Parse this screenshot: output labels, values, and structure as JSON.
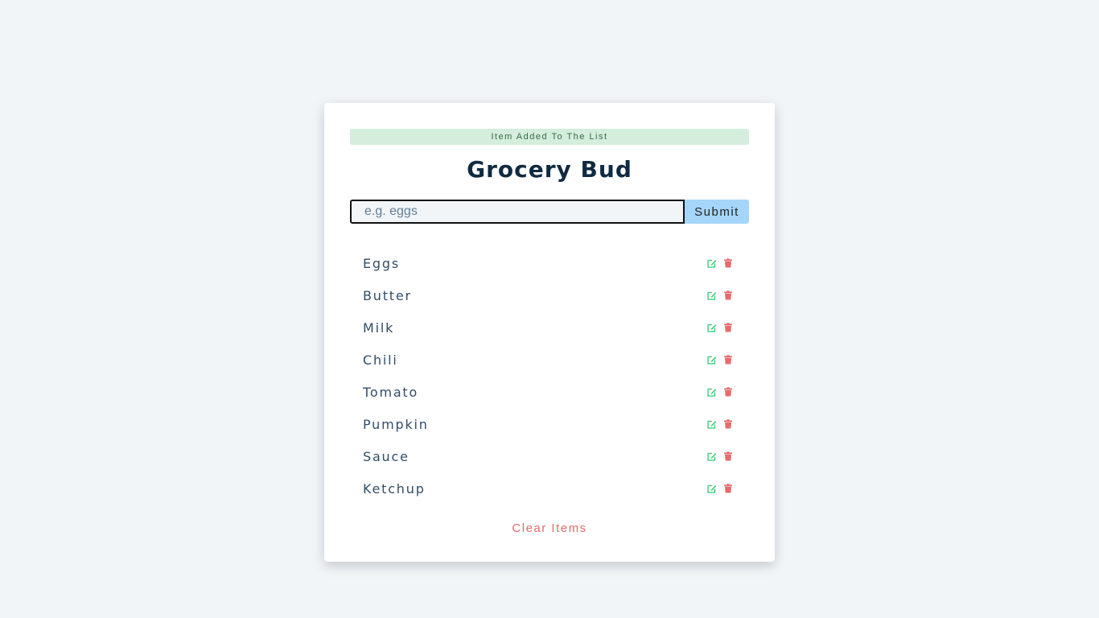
{
  "alert": {
    "text": "Item Added To The List",
    "color": "#d4eddc"
  },
  "header": {
    "title": "Grocery Bud"
  },
  "form": {
    "input_value": "",
    "input_placeholder": "e.g. eggs",
    "submit_label": "Submit",
    "submit_color": "#a5d5f8"
  },
  "items": [
    {
      "name": "Eggs"
    },
    {
      "name": "Butter"
    },
    {
      "name": "Milk"
    },
    {
      "name": "Chili"
    },
    {
      "name": "Tomato"
    },
    {
      "name": "Pumpkin"
    },
    {
      "name": "Sauce"
    },
    {
      "name": "Ketchup"
    }
  ],
  "icons": {
    "edit": "edit-icon",
    "delete": "trash-icon",
    "edit_color": "#2ecc71",
    "delete_color": "#e66b6b"
  },
  "footer": {
    "clear_label": "Clear Items"
  }
}
